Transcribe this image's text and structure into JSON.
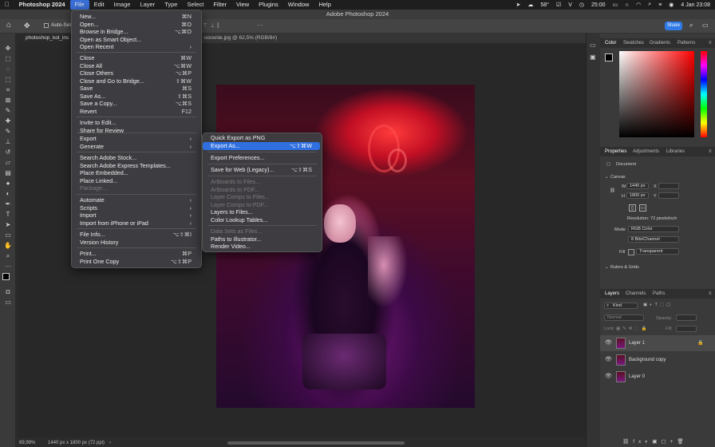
{
  "menubar": {
    "app": "Photoshop 2024",
    "items": [
      "File",
      "Edit",
      "Image",
      "Layer",
      "Type",
      "Select",
      "Filter",
      "View",
      "Plugins",
      "Window",
      "Help"
    ],
    "temperature": "58°",
    "time": "25:00",
    "date": "4 Jan 23:08",
    "accent": "#3a6fd8"
  },
  "window": {
    "title": "Adobe Photoshop 2024"
  },
  "options": {
    "auto_select": "Auto-Sele",
    "share": "Share"
  },
  "tabs": {
    "doc1": "photoshop_kol_ins",
    "doc2": "oooxnie.jpg @ 62,5% (RGB/8#)"
  },
  "file_menu": [
    {
      "label": "New...",
      "key": "⌘N"
    },
    {
      "label": "Open...",
      "key": "⌘O"
    },
    {
      "label": "Browse in Bridge...",
      "key": "⌥⌘O"
    },
    {
      "label": "Open as Smart Object...",
      "key": ""
    },
    {
      "label": "Open Recent",
      "key": "›"
    },
    {
      "label": "Close",
      "key": "⌘W"
    },
    {
      "label": "Close All",
      "key": "⌥⌘W"
    },
    {
      "label": "Close Others",
      "key": "⌥⌘P"
    },
    {
      "label": "Close and Go to Bridge...",
      "key": "⇧⌘W"
    },
    {
      "label": "Save",
      "key": "⌘S"
    },
    {
      "label": "Save As...",
      "key": "⇧⌘S"
    },
    {
      "label": "Save a Copy...",
      "key": "⌥⌘S"
    },
    {
      "label": "Revert",
      "key": "F12"
    },
    {
      "label": "Invite to Edit...",
      "key": ""
    },
    {
      "label": "Share for Review",
      "key": ""
    },
    {
      "label": "Export",
      "key": "›"
    },
    {
      "label": "Generate",
      "key": "›"
    },
    {
      "label": "Search Adobe Stock...",
      "key": ""
    },
    {
      "label": "Search Adobe Express Templates...",
      "key": ""
    },
    {
      "label": "Place Embedded...",
      "key": ""
    },
    {
      "label": "Place Linked...",
      "key": ""
    },
    {
      "label": "Package...",
      "key": ""
    },
    {
      "label": "Automate",
      "key": "›"
    },
    {
      "label": "Scripts",
      "key": "›"
    },
    {
      "label": "Import",
      "key": "›"
    },
    {
      "label": "Import from iPhone or iPad",
      "key": "›"
    },
    {
      "label": "File Info...",
      "key": "⌥⇧⌘I"
    },
    {
      "label": "Version History",
      "key": ""
    },
    {
      "label": "Print...",
      "key": "⌘P"
    },
    {
      "label": "Print One Copy",
      "key": "⌥⇧⌘P"
    }
  ],
  "export_menu": [
    {
      "label": "Quick Export as PNG",
      "key": ""
    },
    {
      "label": "Export As...",
      "key": "⌥⇧⌘W"
    },
    {
      "label": "Export Preferences...",
      "key": ""
    },
    {
      "label": "Save for Web (Legacy)...",
      "key": "⌥⇧⌘S"
    },
    {
      "label": "Artboards to Files...",
      "key": ""
    },
    {
      "label": "Artboards to PDF...",
      "key": ""
    },
    {
      "label": "Layer Comps to Files...",
      "key": ""
    },
    {
      "label": "Layer Comps to PDF...",
      "key": ""
    },
    {
      "label": "Layers to Files...",
      "key": ""
    },
    {
      "label": "Color Lookup Tables...",
      "key": ""
    },
    {
      "label": "Data Sets as Files...",
      "key": ""
    },
    {
      "label": "Paths to Illustrator...",
      "key": ""
    },
    {
      "label": "Render Video...",
      "key": ""
    }
  ],
  "color_panel": {
    "tabs": [
      "Color",
      "Swatches",
      "Gradients",
      "Patterns"
    ]
  },
  "properties": {
    "tabs": [
      "Properties",
      "Adjustments",
      "Libraries"
    ],
    "document": "Document",
    "canvas": "Canvas",
    "w_label": "W",
    "w": "1440 px",
    "h_label": "H",
    "h": "1800 px",
    "x_label": "X",
    "y_label": "Y",
    "resolution": "Resolution: 72 pixels/inch",
    "mode_label": "Mode",
    "mode": "RGB Color",
    "bits": "8 Bits/Channel",
    "fill_label": "Fill",
    "fill": "Transparent",
    "rulers": "Rulers & Grids"
  },
  "layers": {
    "tabs": [
      "Layers",
      "Channels",
      "Paths"
    ],
    "kind": "Kind",
    "blend": "Normal",
    "opacity_label": "Opacity:",
    "lock_label": "Lock:",
    "fill_label": "Fill:",
    "items": [
      "Layer 1",
      "Background copy",
      "Layer 0"
    ]
  },
  "status": {
    "zoom": "89,99%",
    "info": "1440 px x 1800 px (72 ppi)"
  }
}
